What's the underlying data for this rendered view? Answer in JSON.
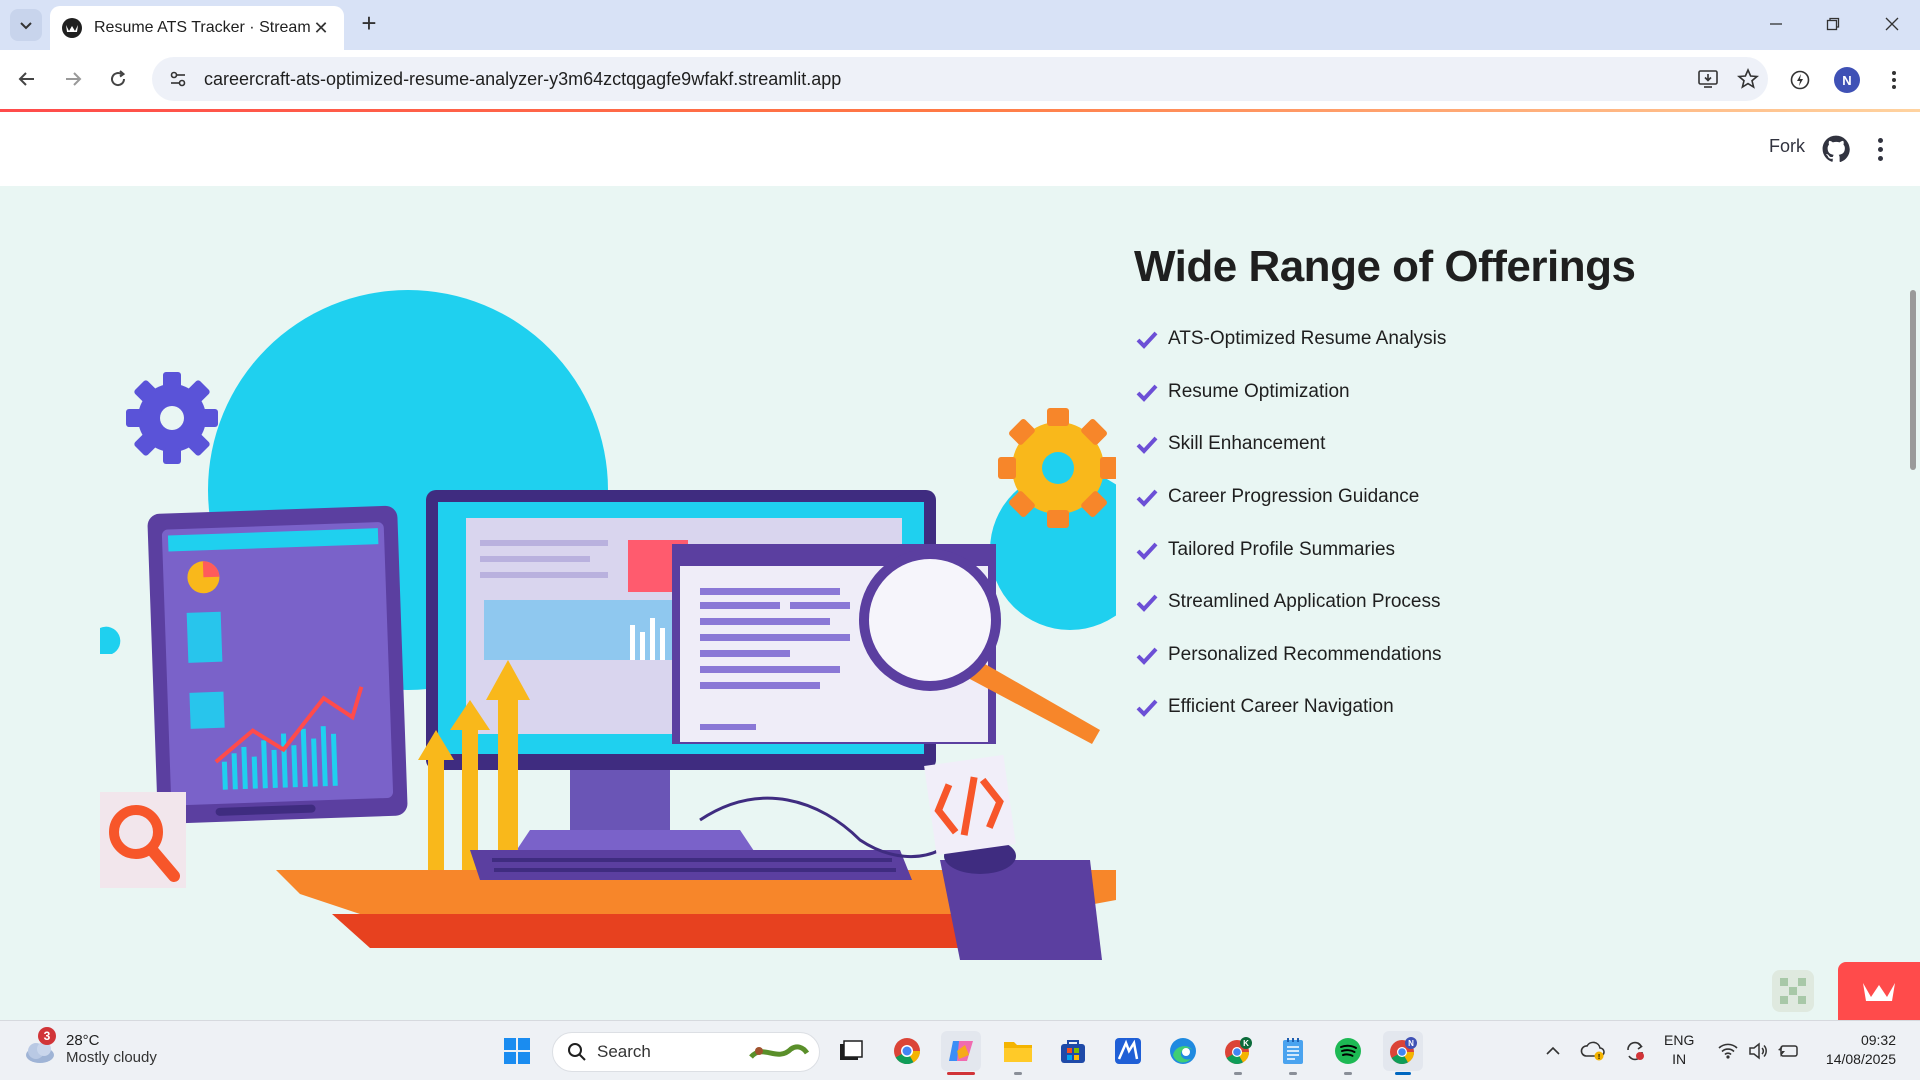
{
  "browser": {
    "tab_title": "Resume ATS Tracker · Streamlit",
    "url": "careercraft-ats-optimized-resume-analyzer-y3m64zctqgagfe9wfakf.streamlit.app",
    "profile_initial": "N"
  },
  "header": {
    "fork_label": "Fork"
  },
  "offerings": {
    "title": "Wide Range of Offerings",
    "items": [
      "ATS-Optimized Resume Analysis",
      "Resume Optimization",
      "Skill Enhancement",
      "Career Progression Guidance",
      "Tailored Profile Summaries",
      "Streamlined Application Process",
      "Personalized Recommendations",
      "Efficient Career Navigation"
    ],
    "check_color": "#6c4fd6"
  },
  "taskbar": {
    "weather_temp": "28°C",
    "weather_condition": "Mostly cloudy",
    "weather_badge": "3",
    "search_placeholder": "Search",
    "language_line1": "ENG",
    "language_line2": "IN",
    "time": "09:32",
    "date": "14/08/2025"
  },
  "colors": {
    "page_bg": "#e9f6f3",
    "streamlit_red": "#ff4b4b",
    "accent_purple": "#5b3fa0",
    "accent_cyan": "#1fd0ef",
    "accent_orange": "#f7862a"
  }
}
